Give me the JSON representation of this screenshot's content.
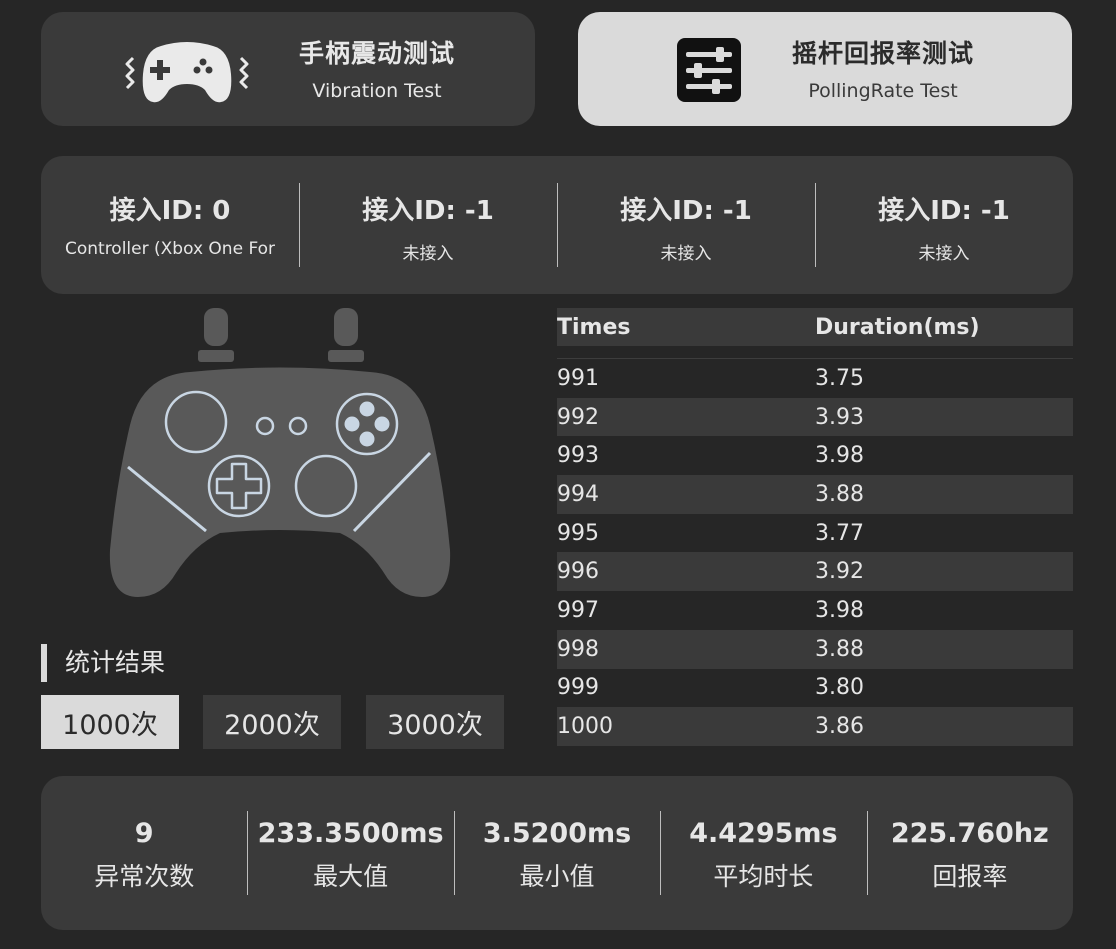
{
  "modes": {
    "vibration": {
      "title": "手柄震动测试",
      "subtitle": "Vibration Test",
      "icon": "gamepad-vibration-icon"
    },
    "polling": {
      "title": "摇杆回报率测试",
      "subtitle": "PollingRate Test",
      "icon": "sliders-icon"
    }
  },
  "slots": [
    {
      "title": "接入ID: 0",
      "status": "Controller (Xbox One For"
    },
    {
      "title": "接入ID: -1",
      "status": "未接入"
    },
    {
      "title": "接入ID: -1",
      "status": "未接入"
    },
    {
      "title": "接入ID: -1",
      "status": "未接入"
    }
  ],
  "stats": {
    "title": "统计结果",
    "buttons": [
      "1000次",
      "2000次",
      "3000次"
    ],
    "selected": "1000次"
  },
  "table": {
    "headers": [
      "Times",
      "Duration(ms)"
    ],
    "rows": [
      [
        "991",
        "3.75"
      ],
      [
        "992",
        "3.93"
      ],
      [
        "993",
        "3.98"
      ],
      [
        "994",
        "3.88"
      ],
      [
        "995",
        "3.77"
      ],
      [
        "996",
        "3.92"
      ],
      [
        "997",
        "3.98"
      ],
      [
        "998",
        "3.88"
      ],
      [
        "999",
        "3.80"
      ],
      [
        "1000",
        "3.86"
      ]
    ]
  },
  "summary": [
    {
      "value": "9",
      "label": "异常次数"
    },
    {
      "value": "233.3500ms",
      "label": "最大值"
    },
    {
      "value": "3.5200ms",
      "label": "最小值"
    },
    {
      "value": "4.4295ms",
      "label": "平均时长"
    },
    {
      "value": "225.760hz",
      "label": "回报率"
    }
  ],
  "colors": {
    "background": "#262626",
    "panel": "#3a3a3a",
    "selected": "#dadada",
    "controller_body": "#595959",
    "controller_line": "#c9d6e3"
  }
}
